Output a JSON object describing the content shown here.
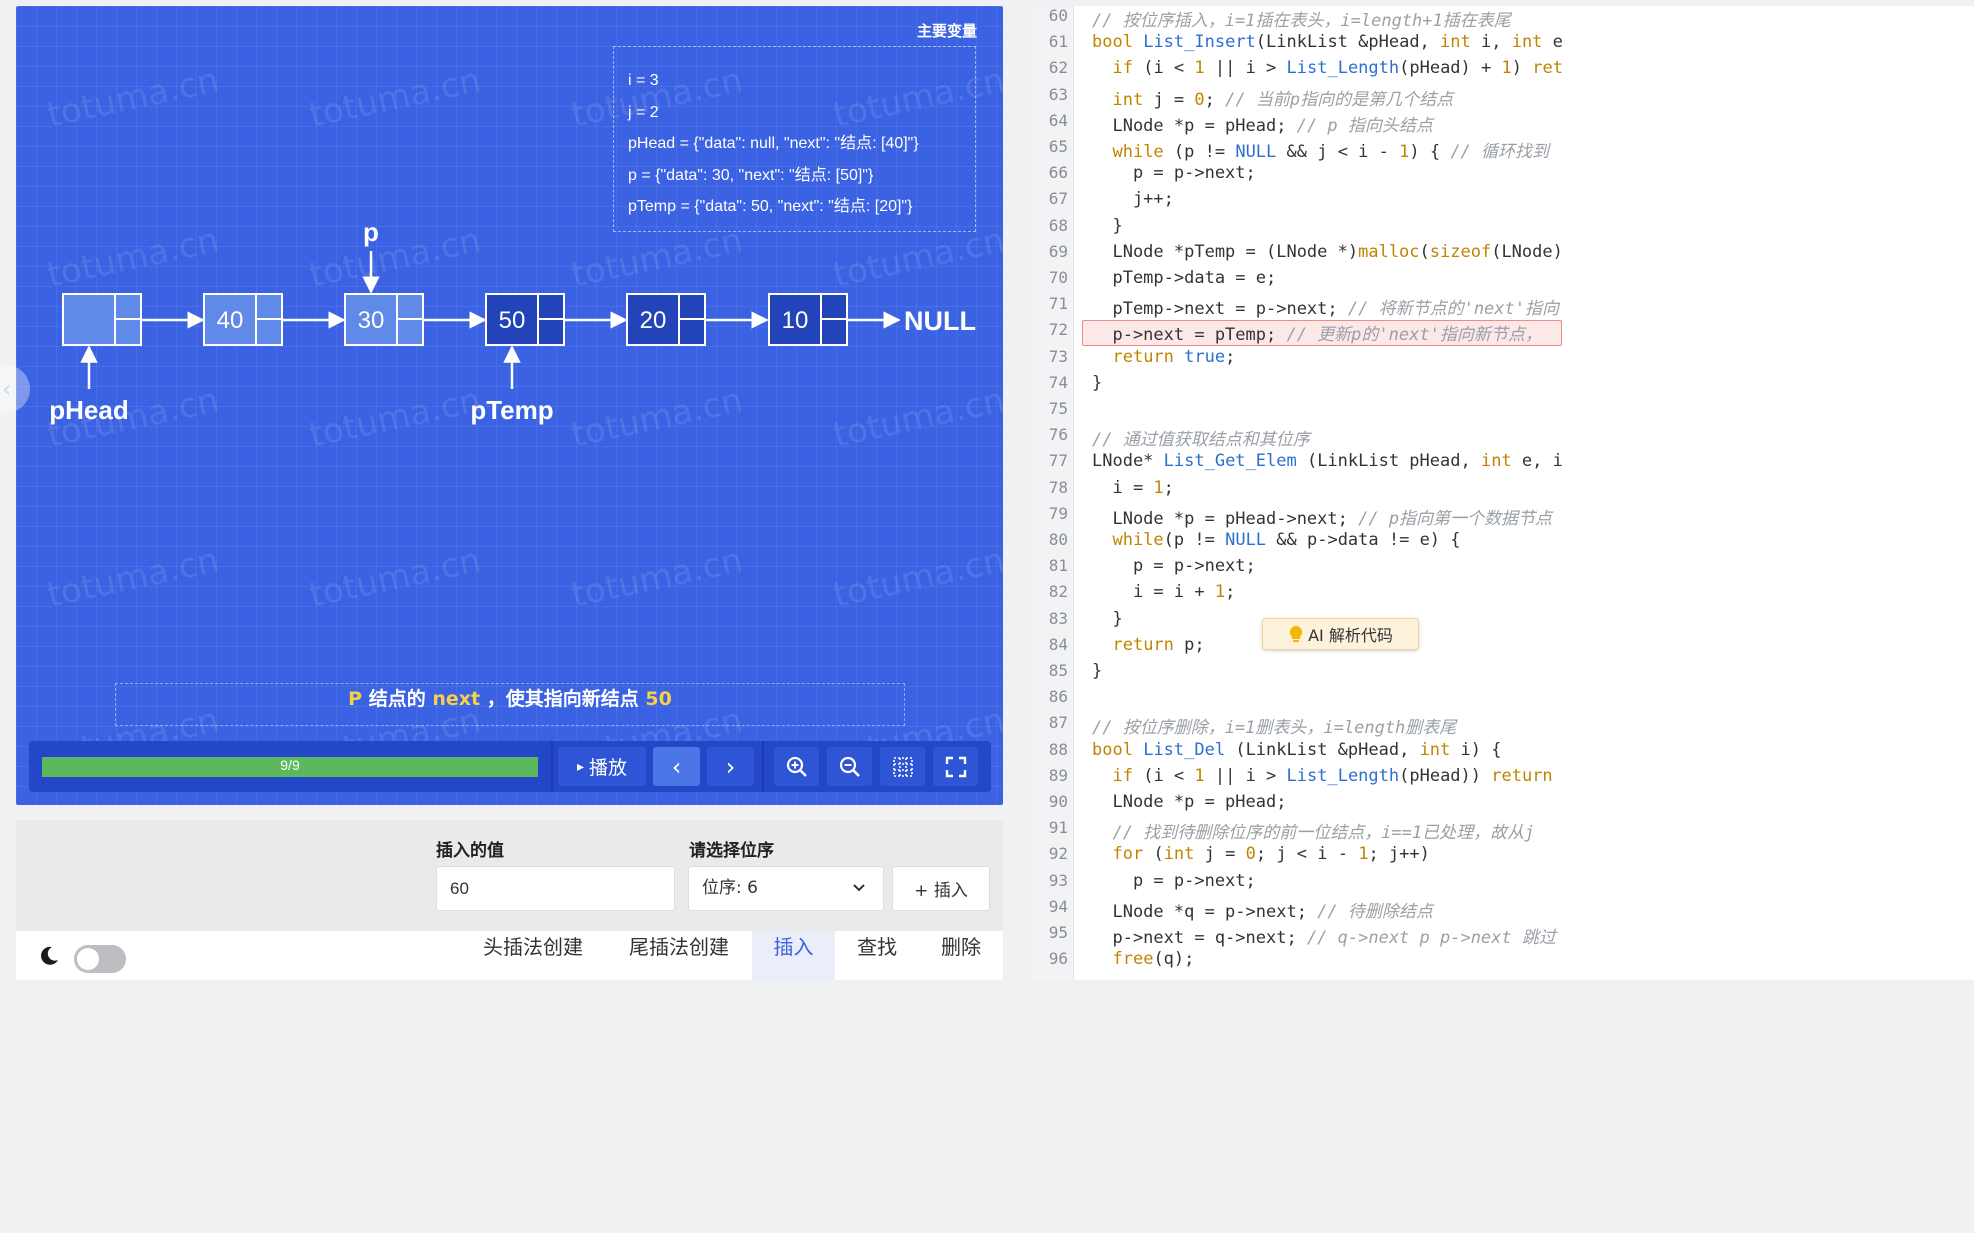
{
  "variables": {
    "title": "主要变量",
    "lines": [
      "i = 3",
      "j = 2",
      "pHead = {\"data\": null, \"next\": \"结点: [40]\"}",
      "p = {\"data\": 30, \"next\": \"结点: [50]\"}",
      "pTemp = {\"data\": 50, \"next\": \"结点: [20]\"}"
    ]
  },
  "linked_list": {
    "nodes": [
      "",
      "40",
      "30",
      "50",
      "20",
      "10"
    ],
    "null_label": "NULL",
    "pointers": {
      "p": "p",
      "pHead": "pHead",
      "pTemp": "pTemp"
    }
  },
  "watermark": "totuma.cn",
  "caption": {
    "p": "P",
    "t1": "结点的",
    "next": "next",
    "t2": "，使其指向新结点",
    "value": "50"
  },
  "controls": {
    "progress_label": "9/9",
    "progress_fraction": 1.0,
    "play_label": "播放",
    "play_icon": "▸",
    "prev_icon": "‹",
    "next_icon": "›",
    "zoom_in_icon": "zoom-in-icon",
    "zoom_out_icon": "zoom-out-icon",
    "grid_icon": "grid-icon",
    "fullscreen_icon": "fullscreen-icon"
  },
  "form": {
    "value_label": "插入的值",
    "value_input": "60",
    "position_label": "请选择位序",
    "position_selected": "位序: 6",
    "insert_button": "+ 插入"
  },
  "tabs": [
    "头插法创建",
    "尾插法创建",
    "插入",
    "查找",
    "删除"
  ],
  "active_tab": "插入",
  "ai_button": "AI 解析代码",
  "code": [
    {
      "ln": "60",
      "html": "<span class=\"c\">// 按位序插入，i=1插在表头，i=length+1插在表尾</span>"
    },
    {
      "ln": "61",
      "html": "<span class=\"t\">bool</span> <span class=\"f\">List_Insert</span>(LinkList &amp;pHead, <span class=\"t\">int</span> i, <span class=\"t\">int</span> e"
    },
    {
      "ln": "62",
      "html": "  <span class=\"k\">if</span> (i &lt; <span class=\"n\">1</span> || i &gt; <span class=\"f\">List_Length</span>(pHead) + <span class=\"n\">1</span>) <span class=\"k\">ret</span>"
    },
    {
      "ln": "63",
      "html": "  <span class=\"t\">int</span> j = <span class=\"n\">0</span>; <span class=\"c\">// 当前p指向的是第几个结点</span>"
    },
    {
      "ln": "64",
      "html": "  LNode *p = pHead; <span class=\"c\">// p 指向头结点</span>"
    },
    {
      "ln": "65",
      "html": "  <span class=\"k\">while</span> (p != <span class=\"f\">NULL</span> &amp;&amp; j &lt; i - <span class=\"n\">1</span>) { <span class=\"c\">// 循环找到</span>"
    },
    {
      "ln": "66",
      "html": "    p = p-&gt;next;"
    },
    {
      "ln": "67",
      "html": "    j++;"
    },
    {
      "ln": "68",
      "html": "  }"
    },
    {
      "ln": "69",
      "html": "  LNode *pTemp = (LNode *)<span class=\"k\">malloc</span>(<span class=\"k\">sizeof</span>(LNode)"
    },
    {
      "ln": "70",
      "html": "  pTemp-&gt;data = e;"
    },
    {
      "ln": "71",
      "html": "  pTemp-&gt;next = p-&gt;next; <span class=\"c\">// 将新节点的'next'指向</span>"
    },
    {
      "ln": "72",
      "html": "  p-&gt;next = pTemp; <span class=\"c\">// 更新p的'next'指向新节点，</span>"
    },
    {
      "ln": "73",
      "html": "  <span class=\"k\">return</span> <span class=\"f\">true</span>;"
    },
    {
      "ln": "74",
      "html": "}"
    },
    {
      "ln": "75",
      "html": ""
    },
    {
      "ln": "76",
      "html": "<span class=\"c\">// 通过值获取结点和其位序</span>"
    },
    {
      "ln": "77",
      "html": "LNode* <span class=\"f\">List_Get_Elem</span> (LinkList pHead, <span class=\"t\">int</span> e, i"
    },
    {
      "ln": "78",
      "html": "  i = <span class=\"n\">1</span>;"
    },
    {
      "ln": "79",
      "html": "  LNode *p = pHead-&gt;next; <span class=\"c\">// p指向第一个数据节点</span>"
    },
    {
      "ln": "80",
      "html": "  <span class=\"k\">while</span>(p != <span class=\"f\">NULL</span> &amp;&amp; p-&gt;data != e) {"
    },
    {
      "ln": "81",
      "html": "    p = p-&gt;next;"
    },
    {
      "ln": "82",
      "html": "    i = i + <span class=\"n\">1</span>;"
    },
    {
      "ln": "83",
      "html": "  }"
    },
    {
      "ln": "84",
      "html": "  <span class=\"k\">return</span> p;"
    },
    {
      "ln": "85",
      "html": "}"
    },
    {
      "ln": "86",
      "html": ""
    },
    {
      "ln": "87",
      "html": "<span class=\"c\">// 按位序删除，i=1删表头，i=length删表尾</span>"
    },
    {
      "ln": "88",
      "html": "<span class=\"t\">bool</span> <span class=\"f\">List_Del</span> (LinkList &amp;pHead, <span class=\"t\">int</span> i) {"
    },
    {
      "ln": "89",
      "html": "  <span class=\"k\">if</span> (i &lt; <span class=\"n\">1</span> || i &gt; <span class=\"f\">List_Length</span>(pHead)) <span class=\"k\">return</span>"
    },
    {
      "ln": "90",
      "html": "  LNode *p = pHead;"
    },
    {
      "ln": "91",
      "html": "  <span class=\"c\">// 找到待删除位序的前一位结点，i==1已处理，故从j</span>"
    },
    {
      "ln": "92",
      "html": "  <span class=\"k\">for</span> (<span class=\"t\">int</span> j = <span class=\"n\">0</span>; j &lt; i - <span class=\"n\">1</span>; j++)"
    },
    {
      "ln": "93",
      "html": "    p = p-&gt;next;"
    },
    {
      "ln": "94",
      "html": "  LNode *q = p-&gt;next; <span class=\"c\">// 待删除结点</span>"
    },
    {
      "ln": "95",
      "html": "  p-&gt;next = q-&gt;next; <span class=\"c\">// q-&gt;next p p-&gt;next 跳过</span>"
    },
    {
      "ln": "96",
      "html": "  <span class=\"k\">free</span>(q);"
    }
  ],
  "highlighted_line": "72"
}
